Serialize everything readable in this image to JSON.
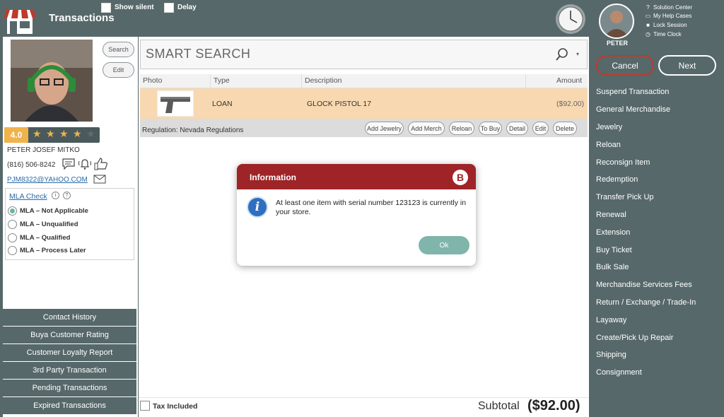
{
  "header": {
    "title": "Transactions",
    "show_silent_label": "Show silent",
    "delay_label": "Delay"
  },
  "user": {
    "name": "PETER",
    "links": [
      "Solution Center",
      "My Help Cases",
      "Lock Session",
      "Time Clock"
    ]
  },
  "buttons": {
    "cancel": "Cancel",
    "next": "Next",
    "search": "Search",
    "edit": "Edit"
  },
  "actions": [
    "Suspend Transaction",
    "General Merchandise",
    "Jewelry",
    "Reloan",
    "Reconsign Item",
    "Redemption",
    "Transfer Pick Up",
    "Renewal",
    "Extension",
    "Buy Ticket",
    "Bulk Sale",
    "Merchandise Services Fees",
    "Return / Exchange / Trade-In",
    "Layaway",
    "Create/Pick Up Repair",
    "Shipping",
    "Consignment"
  ],
  "customer": {
    "rating": "4.0",
    "stars_filled": 4,
    "name": "PETER JOSEF MITKO",
    "phone": "(816) 506-8242",
    "email": "PJM8322@YAHOO.COM",
    "mla_check": "MLA Check",
    "mla_options": [
      "MLA – Not Applicable",
      "MLA – Unqualified",
      "MLA – Qualified",
      "MLA – Process Later"
    ],
    "mla_selected": 0
  },
  "left_nav": [
    "Contact History",
    "Buya Customer Rating",
    "Customer Loyalty Report",
    "3rd Party Transaction",
    "Pending Transactions",
    "Expired Transactions"
  ],
  "search": {
    "placeholder": "SMART SEARCH"
  },
  "table": {
    "headers": [
      "Photo",
      "Type",
      "Description",
      "Amount"
    ],
    "rows": [
      {
        "type": "LOAN",
        "description": "GLOCK PISTOL 17",
        "amount": "($92.00)"
      }
    ]
  },
  "regulation": {
    "text": "Regulation: Nevada Regulations",
    "actions": [
      "Add Jewelry",
      "Add Merch",
      "Reloan",
      "To Buy",
      "Detail",
      "Edit",
      "Delete"
    ]
  },
  "footer": {
    "tax_label": "Tax Included",
    "subtotal_label": "Subtotal",
    "subtotal_value": "($92.00)"
  },
  "dialog": {
    "title": "Information",
    "logo_letter": "B",
    "message": "At least one item with serial number 123123 is currently in your store.",
    "ok_label": "Ok"
  },
  "colors": {
    "panel": "#57686a",
    "accent_red": "#9e2427",
    "star": "#f0b24b",
    "row_highlight": "#f7d8b0",
    "ok_button": "#7fb5ab"
  }
}
